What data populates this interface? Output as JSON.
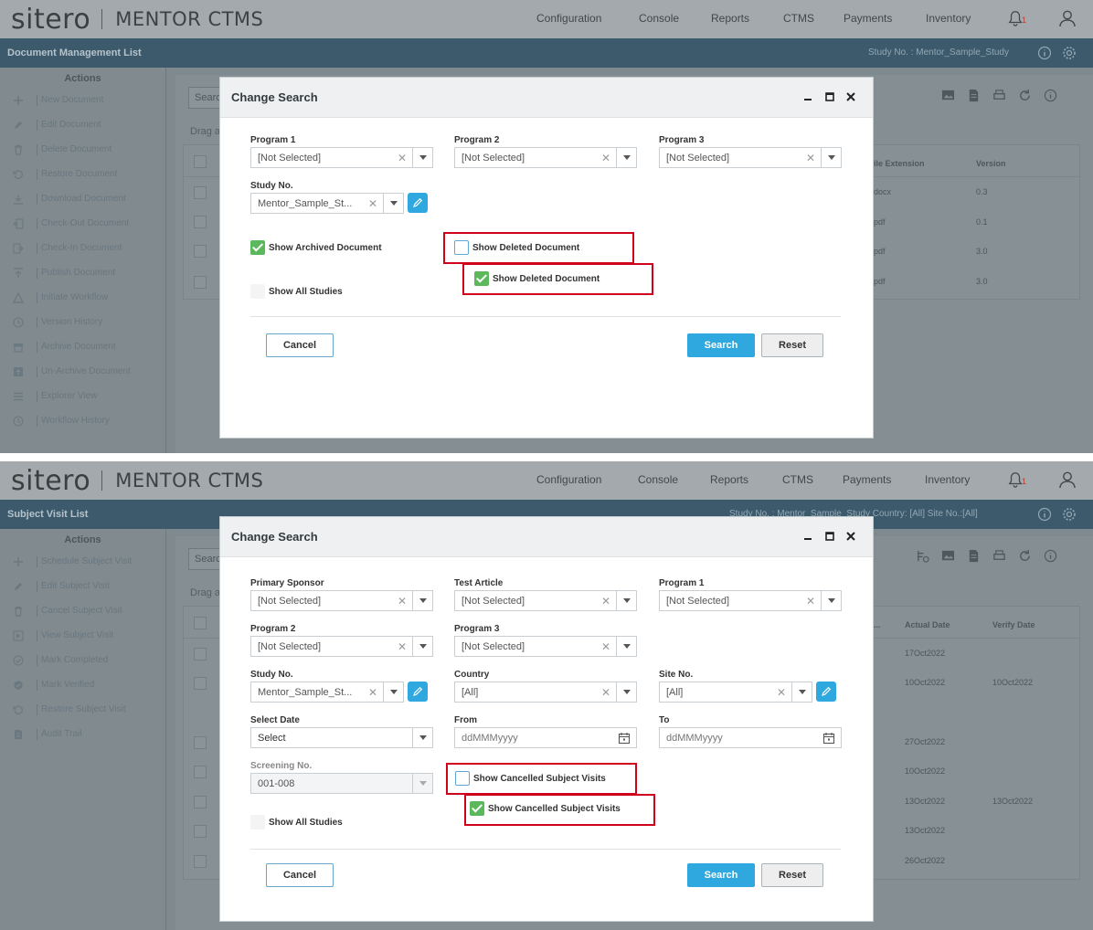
{
  "common": {
    "logo": "sitero",
    "product": "MENTOR CTMS",
    "nav": [
      "Configuration",
      "Console",
      "Reports",
      "CTMS",
      "Payments",
      "Inventory"
    ],
    "notification_count": "1",
    "icons": [
      "bell-icon",
      "user-icon",
      "info-icon",
      "gear-icon",
      "minimize-icon",
      "maximize-icon",
      "close-icon",
      "pencil-icon",
      "calendar-icon"
    ]
  },
  "shot1": {
    "page_title": "Document Management List",
    "study_info": "Study No. : Mentor_Sample_Study",
    "actions_title": "Actions",
    "actions": [
      "New Document",
      "Edit Document",
      "Delete Document",
      "Restore Document",
      "Download Document",
      "Check-Out Document",
      "Check-In Document",
      "Publish Document",
      "Initiate Workflow",
      "Version History",
      "Archive Document",
      "Un-Archive Document",
      "Explorer View",
      "Workflow History"
    ],
    "search_stub": "Searc",
    "drag_stub": "Drag a",
    "grid_columns": [
      "ile Extension",
      "Version"
    ],
    "grid_rows": [
      [
        "docx",
        "0.3"
      ],
      [
        "pdf",
        "0.1"
      ],
      [
        "pdf",
        "3.0"
      ],
      [
        "pdf",
        "3.0"
      ]
    ],
    "modal": {
      "title": "Change Search",
      "program1_label": "Program 1",
      "program1_value": "[Not Selected]",
      "program2_label": "Program 2",
      "program2_value": "[Not Selected]",
      "program3_label": "Program 3",
      "program3_value": "[Not Selected]",
      "study_label": "Study No.",
      "study_value": "Mentor_Sample_St...",
      "show_archived": "Show Archived Document",
      "show_deleted_unchecked": "Show Deleted Document",
      "show_deleted_checked": "Show Deleted Document",
      "show_all_studies": "Show All Studies",
      "cancel": "Cancel",
      "search": "Search",
      "reset": "Reset"
    }
  },
  "shot2": {
    "page_title": "Subject Visit List",
    "study_info": "Study No. : Mentor_Sample_Study   Country: [All]   Site No.:[All]",
    "actions_title": "Actions",
    "actions": [
      "Schedule Subject Visit",
      "Edit Subject Visit",
      "Cancel Subject Visit",
      "View Subject Visit",
      "Mark Completed",
      "Mark Verified",
      "Restore Subject Visit",
      "Audit Trail"
    ],
    "search_stub": "Searc",
    "drag_stub": "Drag a",
    "grid_columns": [
      "...",
      "Actual Date",
      "Verify Date"
    ],
    "grid_rows": [
      [
        "17Oct2022",
        ""
      ],
      [
        "10Oct2022",
        "10Oct2022"
      ],
      [
        "",
        ""
      ],
      [
        "27Oct2022",
        ""
      ],
      [
        "10Oct2022",
        ""
      ],
      [
        "13Oct2022",
        "13Oct2022"
      ],
      [
        "13Oct2022",
        ""
      ],
      [
        "26Oct2022",
        ""
      ]
    ],
    "modal": {
      "title": "Change Search",
      "primary_sponsor_label": "Primary Sponsor",
      "primary_sponsor_value": "[Not Selected]",
      "test_article_label": "Test Article",
      "test_article_value": "[Not Selected]",
      "program1_label": "Program 1",
      "program1_value": "[Not Selected]",
      "program2_label": "Program 2",
      "program2_value": "[Not Selected]",
      "program3_label": "Program 3",
      "program3_value": "[Not Selected]",
      "study_label": "Study No.",
      "study_value": "Mentor_Sample_St...",
      "country_label": "Country",
      "country_value": "[All]",
      "site_label": "Site No.",
      "site_value": "[All]",
      "select_date_label": "Select Date",
      "select_date_value": "Select",
      "from_label": "From",
      "from_placeholder": "ddMMMyyyy",
      "to_label": "To",
      "to_placeholder": "ddMMMyyyy",
      "screening_label": "Screening No.",
      "screening_value": "001-008",
      "show_cancelled_unchecked": "Show Cancelled Subject Visits",
      "show_cancelled_checked": "Show Cancelled Subject Visits",
      "show_all_studies": "Show All Studies",
      "cancel": "Cancel",
      "search": "Search",
      "reset": "Reset"
    }
  }
}
